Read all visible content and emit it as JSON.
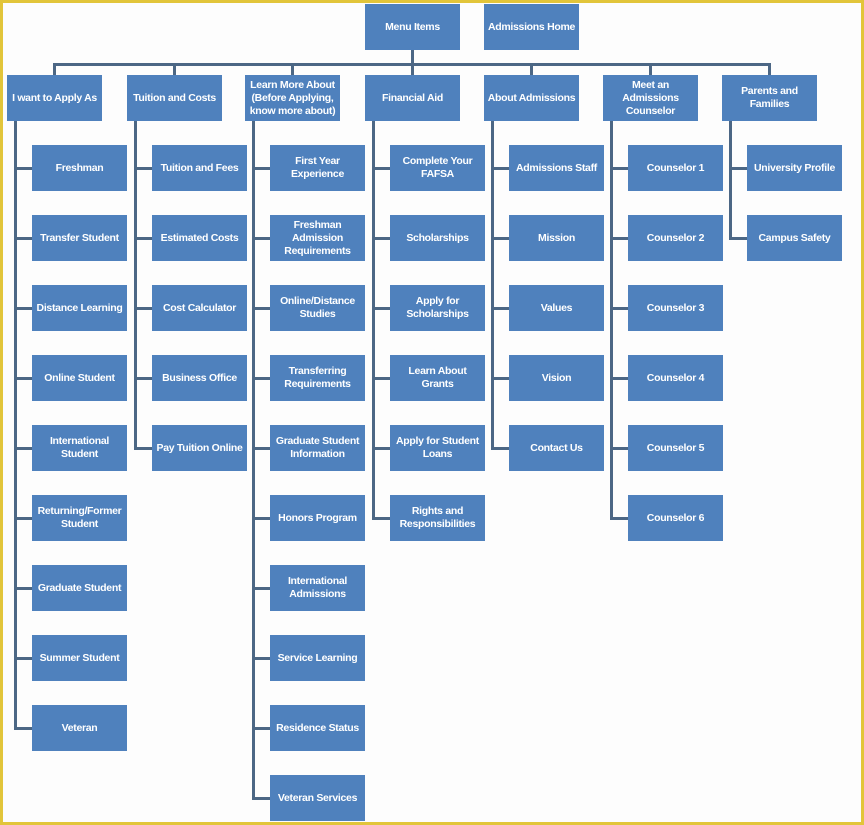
{
  "root": {
    "label": "Menu Items"
  },
  "home": {
    "label": "Admissions Home"
  },
  "colors": {
    "box": "#4f81bd",
    "connector": "#4c6785",
    "frame": "#e2c53a"
  },
  "columns": [
    {
      "label": "I want to Apply As",
      "children": [
        "Freshman",
        "Transfer Student",
        "Distance Learning",
        "Online Student",
        "International\nStudent",
        "Returning/Former\nStudent",
        "Graduate Student",
        "Summer Student",
        "Veteran"
      ]
    },
    {
      "label": "Tuition and Costs",
      "children": [
        "Tuition and Fees",
        "Estimated Costs",
        "Cost Calculator",
        "Business Office",
        "Pay Tuition Online"
      ]
    },
    {
      "label": "Learn More About\n(Before Applying,\nknow more about)",
      "children": [
        "First Year\nExperience",
        "Freshman\nAdmission\nRequirements",
        "Online/Distance\nStudies",
        "Transferring\nRequirements",
        "Graduate Student\nInformation",
        "Honors Program",
        "International\nAdmissions",
        "Service Learning",
        "Residence Status",
        "Veteran Services"
      ]
    },
    {
      "label": "Financial Aid",
      "children": [
        "Complete Your\nFAFSA",
        "Scholarships",
        "Apply for\nScholarships",
        "Learn About  Grants",
        "Apply for Student\nLoans",
        "Rights and\nResponsibilities"
      ]
    },
    {
      "label": "About Admissions",
      "children": [
        "Admissions Staff",
        "Mission",
        "Values",
        "Vision",
        "Contact Us"
      ]
    },
    {
      "label": "Meet an\nAdmissions\nCounselor",
      "children": [
        "Counselor 1",
        "Counselor 2",
        "Counselor 3",
        "Counselor 4",
        "Counselor 5",
        "Counselor 6"
      ]
    },
    {
      "label": "Parents and\nFamilies",
      "children": [
        "University Profile",
        "Campus Safety"
      ]
    }
  ]
}
